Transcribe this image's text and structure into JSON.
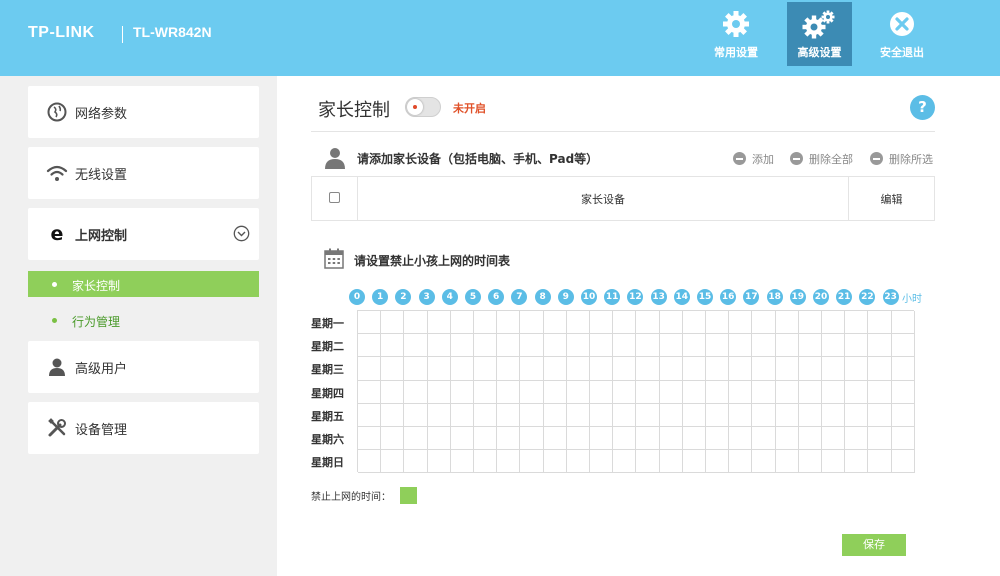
{
  "header": {
    "brand": "TP-LINK",
    "model": "TL-WR842N",
    "nav": [
      {
        "label": "常用设置",
        "icon": "gear-icon"
      },
      {
        "label": "高级设置",
        "icon": "gears-icon",
        "active": true
      },
      {
        "label": "安全退出",
        "icon": "close-circle-icon"
      }
    ]
  },
  "sidebar": {
    "items": [
      {
        "label": "网络参数",
        "icon": "globe-icon"
      },
      {
        "label": "无线设置",
        "icon": "wifi-icon"
      },
      {
        "label": "上网控制",
        "icon": "internet-explorer-icon",
        "expanded": true
      },
      {
        "label": "高级用户",
        "icon": "user-icon"
      },
      {
        "label": "设备管理",
        "icon": "tools-icon"
      }
    ],
    "subitems": [
      {
        "label": "家长控制",
        "active": true
      },
      {
        "label": "行为管理",
        "active": false
      }
    ]
  },
  "main": {
    "title": "家长控制",
    "toggle_status": "未开启",
    "help": "?",
    "devices": {
      "title": "请添加家长设备（包括电脑、手机、Pad等）",
      "actions": [
        "添加",
        "删除全部",
        "删除所选"
      ],
      "columns": [
        "家长设备",
        "编辑"
      ]
    },
    "schedule": {
      "title": "请设置禁止小孩上网的时间表",
      "hours": [
        "0",
        "1",
        "2",
        "3",
        "4",
        "5",
        "6",
        "7",
        "8",
        "9",
        "10",
        "11",
        "12",
        "13",
        "14",
        "15",
        "16",
        "17",
        "18",
        "19",
        "20",
        "21",
        "22",
        "23"
      ],
      "hour_unit": "小时",
      "days": [
        "星期一",
        "星期二",
        "星期三",
        "星期四",
        "星期五",
        "星期六",
        "星期日"
      ],
      "legend_label": "禁止上网的时间："
    },
    "save_label": "保存"
  },
  "colors": {
    "header_bg": "#6ccbf0",
    "nav_active": "#3c8bb4",
    "accent_green": "#8fcf5a",
    "accent_blue": "#5bbde6",
    "status_red": "#e0522a"
  }
}
